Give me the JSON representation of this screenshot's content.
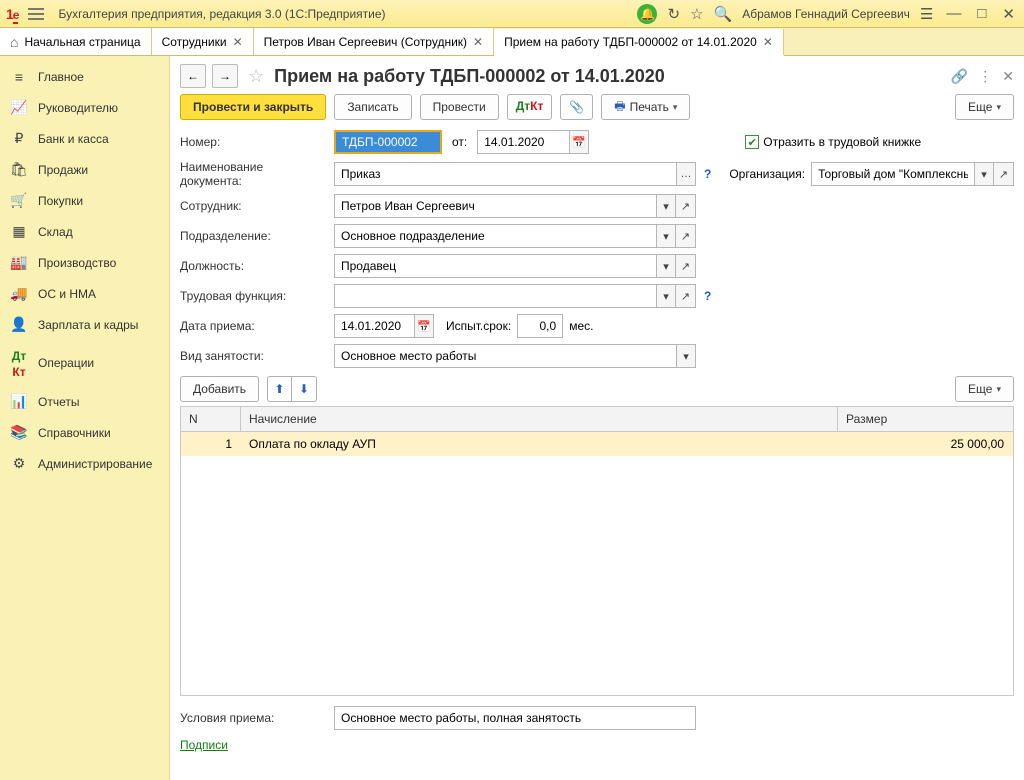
{
  "sysbar": {
    "app_title": "Бухгалтерия предприятия, редакция 3.0  (1С:Предприятие)",
    "user": "Абрамов Геннадий Сергеевич"
  },
  "tabs": {
    "home": "Начальная страница",
    "t1": "Сотрудники",
    "t2": "Петров Иван Сергеевич (Сотрудник)",
    "t3": "Прием на работу ТДБП-000002 от 14.01.2020"
  },
  "sidebar": [
    "Главное",
    "Руководителю",
    "Банк и касса",
    "Продажи",
    "Покупки",
    "Склад",
    "Производство",
    "ОС и НМА",
    "Зарплата и кадры",
    "Операции",
    "Отчеты",
    "Справочники",
    "Администрирование"
  ],
  "page": {
    "title": "Прием на работу ТДБП-000002 от 14.01.2020"
  },
  "toolbar": {
    "post_close": "Провести и закрыть",
    "save": "Записать",
    "post": "Провести",
    "print": "Печать",
    "more": "Еще"
  },
  "form": {
    "number_lbl": "Номер:",
    "number_val": "ТДБП-000002",
    "from_lbl": "от:",
    "date_val": "14.01.2020",
    "reflect_lbl": "Отразить в трудовой книжке",
    "docname_lbl": "Наименование документа:",
    "docname_val": "Приказ",
    "org_lbl": "Организация:",
    "org_val": "Торговый дом \"Комплексный\"",
    "emp_lbl": "Сотрудник:",
    "emp_val": "Петров Иван Сергеевич",
    "dept_lbl": "Подразделение:",
    "dept_val": "Основное подразделение",
    "pos_lbl": "Должность:",
    "pos_val": "Продавец",
    "func_lbl": "Трудовая функция:",
    "func_val": "",
    "hiredate_lbl": "Дата приема:",
    "hiredate_val": "14.01.2020",
    "probation_lbl": "Испыт.срок:",
    "probation_val": "0,0",
    "probation_unit": "мес.",
    "emptype_lbl": "Вид занятости:",
    "emptype_val": "Основное место работы",
    "add": "Добавить",
    "cond_lbl": "Условия приема:",
    "cond_val": "Основное место работы, полная занятость",
    "sign_link": "Подписи"
  },
  "grid": {
    "h_n": "N",
    "h_acc": "Начисление",
    "h_sz": "Размер",
    "r1_n": "1",
    "r1_acc": "Оплата по окладу АУП",
    "r1_sz": "25 000,00"
  }
}
